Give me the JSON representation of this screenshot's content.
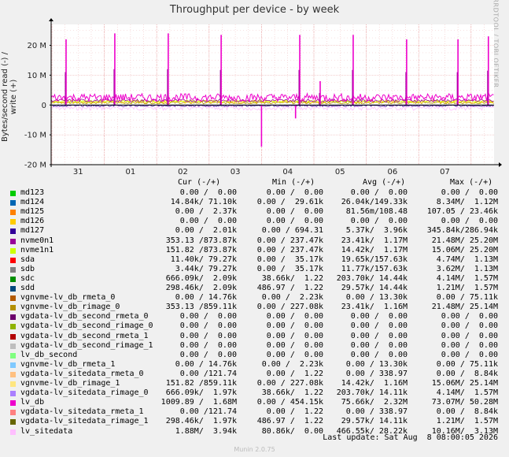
{
  "chart_data": {
    "type": "line",
    "title": "Throughput per device - by week",
    "ylabel": "Bytes/second read (-) / write (+)",
    "ylim": [
      -20000000,
      27000000
    ],
    "yticks": [
      {
        "v": 20000000,
        "label": "20 M"
      },
      {
        "v": 10000000,
        "label": "10 M"
      },
      {
        "v": 0,
        "label": "0"
      },
      {
        "v": -10000000,
        "label": "-10 M"
      },
      {
        "v": -20000000,
        "label": "-20 M"
      }
    ],
    "xticks": [
      "31",
      "01",
      "02",
      "03",
      "04",
      "05",
      "06",
      "07"
    ],
    "grid": true,
    "series_note": "Aggregated throughput traces; lv_db write peaks near 22-24 M, read dip near -14 M",
    "spikes": [
      {
        "day": 0.27,
        "value": 22000000
      },
      {
        "day": 1.2,
        "value": 24000000
      },
      {
        "day": 2.22,
        "value": 24000000
      },
      {
        "day": 3.23,
        "value": 23500000
      },
      {
        "day": 4.73,
        "value": 23500000
      },
      {
        "day": 5.12,
        "value": 8000000
      },
      {
        "day": 5.75,
        "value": 23500000
      },
      {
        "day": 6.77,
        "value": 22000000
      },
      {
        "day": 7.75,
        "value": 22000000
      },
      {
        "day": 8.33,
        "value": 23000000
      },
      {
        "day": 4.0,
        "value": -14000000
      },
      {
        "day": 4.65,
        "value": -4500000
      }
    ]
  },
  "legend": {
    "headers": {
      "cur": "Cur (-/+)",
      "min": "Min (-/+)",
      "avg": "Avg (-/+)",
      "max": "Max (-/+)"
    },
    "rows": [
      {
        "name": "md123",
        "color": "#00cc00",
        "cur": "0.00 /  0.00",
        "min": "0.00 /  0.00",
        "avg": "0.00 /  0.00",
        "max": "0.00 /  0.00"
      },
      {
        "name": "md124",
        "color": "#0066b3",
        "cur": "14.84k/ 71.10k",
        "min": "0.00 /  29.61k",
        "avg": "26.04k/149.33k",
        "max": "8.34M/  1.12M"
      },
      {
        "name": "md125",
        "color": "#ff8000",
        "cur": "0.00 /  2.37k",
        "min": "0.00 /  0.00",
        "avg": "81.56m/108.48",
        "max": "107.05 / 23.46k"
      },
      {
        "name": "md126",
        "color": "#ffcc00",
        "cur": "0.00 /  0.00",
        "min": "0.00 /  0.00",
        "avg": "0.00 /  0.00",
        "max": "0.00 /  0.00"
      },
      {
        "name": "md127",
        "color": "#330099",
        "cur": "0.00 /  2.01k",
        "min": "0.00 / 694.31",
        "avg": "5.37k/  3.96k",
        "max": "345.84k/286.94k"
      },
      {
        "name": "nvme0n1",
        "color": "#990099",
        "cur": "353.13 /873.87k",
        "min": "0.00 / 237.47k",
        "avg": "23.41k/  1.17M",
        "max": "21.48M/ 25.20M"
      },
      {
        "name": "nvme1n1",
        "color": "#ccff00",
        "cur": "151.82 /873.87k",
        "min": "0.00 / 237.47k",
        "avg": "14.42k/  1.17M",
        "max": "15.06M/ 25.20M"
      },
      {
        "name": "sda",
        "color": "#ff0000",
        "cur": "11.40k/ 79.27k",
        "min": "0.00 /  35.17k",
        "avg": "19.65k/157.63k",
        "max": "4.74M/  1.13M"
      },
      {
        "name": "sdb",
        "color": "#808080",
        "cur": "3.44k/ 79.27k",
        "min": "0.00 /  35.17k",
        "avg": "11.77k/157.63k",
        "max": "3.62M/  1.13M"
      },
      {
        "name": "sdc",
        "color": "#008f00",
        "cur": "666.09k/  2.09k",
        "min": "38.66k/  1.22",
        "avg": "203.70k/ 14.44k",
        "max": "4.14M/  1.57M"
      },
      {
        "name": "sdd",
        "color": "#00487d",
        "cur": "298.46k/  2.09k",
        "min": "486.97 /  1.22",
        "avg": "29.57k/ 14.44k",
        "max": "1.21M/  1.57M"
      },
      {
        "name": "vgnvme-lv_db_rmeta_0",
        "color": "#b35a00",
        "cur": "0.00 / 14.76k",
        "min": "0.00 /  2.23k",
        "avg": "0.00 / 13.30k",
        "max": "0.00 / 75.11k"
      },
      {
        "name": "vgnvme-lv_db_rimage_0",
        "color": "#b38f00",
        "cur": "353.13 /859.11k",
        "min": "0.00 / 227.08k",
        "avg": "23.41k/  1.16M",
        "max": "21.48M/ 25.14M"
      },
      {
        "name": "vgdata-lv_db_second_rmeta_0",
        "color": "#6b006b",
        "cur": "0.00 /  0.00",
        "min": "0.00 /  0.00",
        "avg": "0.00 /  0.00",
        "max": "0.00 /  0.00"
      },
      {
        "name": "vgdata-lv_db_second_rimage_0",
        "color": "#8fb300",
        "cur": "0.00 /  0.00",
        "min": "0.00 /  0.00",
        "avg": "0.00 /  0.00",
        "max": "0.00 /  0.00"
      },
      {
        "name": "vgdata-lv_db_second_rmeta_1",
        "color": "#b30000",
        "cur": "0.00 /  0.00",
        "min": "0.00 /  0.00",
        "avg": "0.00 /  0.00",
        "max": "0.00 /  0.00"
      },
      {
        "name": "vgdata-lv_db_second_rimage_1",
        "color": "#bebebe",
        "cur": "0.00 /  0.00",
        "min": "0.00 /  0.00",
        "avg": "0.00 /  0.00",
        "max": "0.00 /  0.00"
      },
      {
        "name": "lv_db_second",
        "color": "#80ff80",
        "cur": "0.00 /  0.00",
        "min": "0.00 /  0.00",
        "avg": "0.00 /  0.00",
        "max": "0.00 /  0.00"
      },
      {
        "name": "vgnvme-lv_db_rmeta_1",
        "color": "#80c9ff",
        "cur": "0.00 / 14.76k",
        "min": "0.00 /  2.23k",
        "avg": "0.00 / 13.30k",
        "max": "0.00 / 75.11k"
      },
      {
        "name": "vgdata-lv_sitedata_rmeta_0",
        "color": "#ffc080",
        "cur": "0.00 /121.74",
        "min": "0.00 /  1.22",
        "avg": "0.00 / 338.97",
        "max": "0.00 /  8.84k"
      },
      {
        "name": "vgnvme-lv_db_rimage_1",
        "color": "#ffe680",
        "cur": "151.82 /859.11k",
        "min": "0.00 / 227.08k",
        "avg": "14.42k/  1.16M",
        "max": "15.06M/ 25.14M"
      },
      {
        "name": "vgdata-lv_sitedata_rimage_0",
        "color": "#aa80ff",
        "cur": "666.09k/  1.97k",
        "min": "38.66k/  1.22",
        "avg": "203.70k/ 14.11k",
        "max": "4.14M/  1.57M"
      },
      {
        "name": "lv_db",
        "color": "#ee00cc",
        "cur": "1009.89 /  1.68M",
        "min": "0.00 / 454.15k",
        "avg": "75.66k/  2.32M",
        "max": "73.07M/ 50.28M"
      },
      {
        "name": "vgdata-lv_sitedata_rmeta_1",
        "color": "#ff8080",
        "cur": "0.00 /121.74",
        "min": "0.00 /  1.22",
        "avg": "0.00 / 338.97",
        "max": "0.00 /  8.84k"
      },
      {
        "name": "vgdata-lv_sitedata_rimage_1",
        "color": "#666600",
        "cur": "298.46k/  1.97k",
        "min": "486.97 /  1.22",
        "avg": "29.57k/ 14.11k",
        "max": "1.21M/  1.57M"
      },
      {
        "name": "lv_sitedata",
        "color": "#ffbfff",
        "cur": "1.88M/  3.94k",
        "min": "80.86k/  0.00",
        "avg": "466.55k/ 28.22k",
        "max": "10.16M/  3.13M"
      }
    ]
  },
  "footer": {
    "last_update": "Last update: Sat Aug  8 08:00:05 2026"
  },
  "vendor_text": "RRDTOOL / TOBI OETIKER",
  "munin_version": "Munin 2.0.75"
}
